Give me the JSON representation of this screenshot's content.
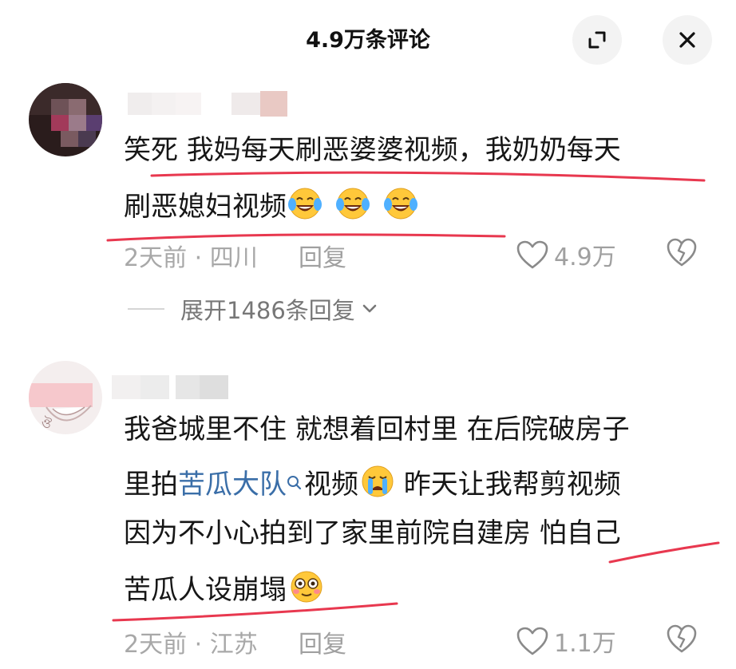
{
  "header": {
    "title": "4.9万条评论",
    "expand_icon": "expand-icon",
    "close_icon": "close-icon"
  },
  "comments": [
    {
      "lines": [
        "笑死 我妈每天刷恶婆婆视频，我奶奶每天",
        "刷恶媳妇视频"
      ],
      "emoji": "tears-of-joy-emoji",
      "emoji_count": 3,
      "time": "2天前",
      "separator": "·",
      "location": "四川",
      "reply_label": "回复",
      "likes": "4.9万",
      "expand_replies": "展开1486条回复"
    },
    {
      "line1": "我爸城里不住 就想着回村里 在后院破房子",
      "line2_pre": "里拍",
      "line2_link": "苦瓜大队",
      "line2_post": "视频",
      "line2_after_emoji": " 昨天让我帮剪视频",
      "line3": "因为不小心拍到了家里前院自建房 怕自己",
      "line4": "苦瓜人设崩塌",
      "time": "2天前",
      "separator": "·",
      "location": "江苏",
      "reply_label": "回复",
      "likes": "1.1万"
    }
  ],
  "colors": {
    "text": "#161616",
    "meta": "#a8a8a8",
    "link": "#3a6ea8",
    "annotation": "#e8384f"
  }
}
